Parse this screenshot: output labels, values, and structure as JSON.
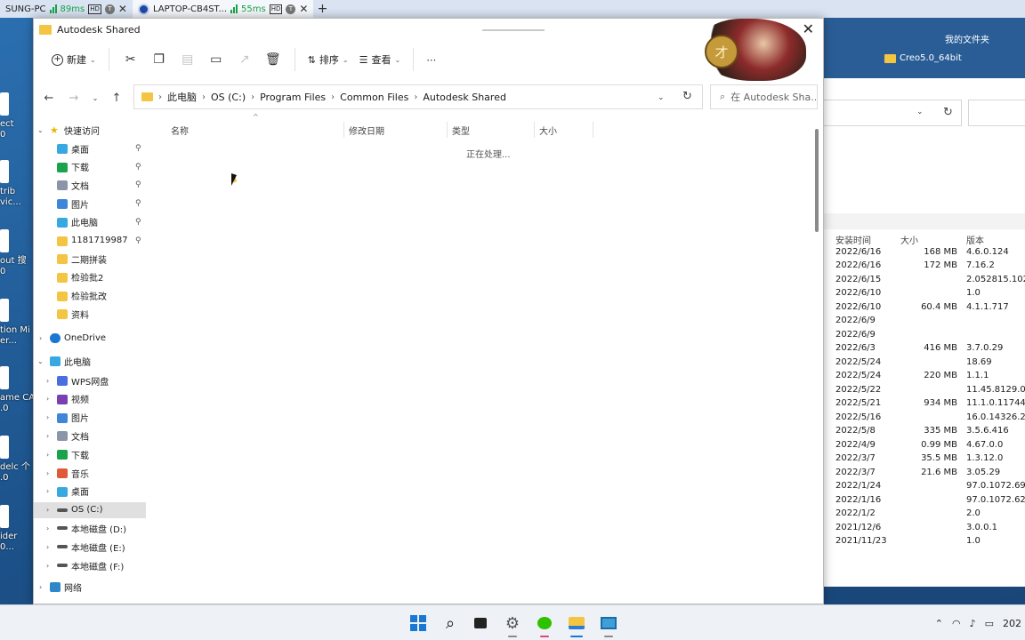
{
  "remote_tabs": [
    {
      "name": "SUNG-PC",
      "latency": "89ms",
      "hd": "HD",
      "t": "T",
      "close": "✕"
    },
    {
      "name": "LAPTOP-CB4ST...",
      "latency": "55ms",
      "hd": "HD",
      "t": "T",
      "close": "✕"
    }
  ],
  "remote_new_tab": "+",
  "desktop_labels": [
    "ect",
    "0",
    "trib",
    "vic...",
    "out",
    "搜",
    "0",
    "tion",
    "er...",
    "Mi",
    "ame",
    "CA",
    ".0",
    "delc",
    "个",
    ".0",
    "ider",
    "0..."
  ],
  "bg_window": {
    "title": "我的文件夹",
    "folder": "Creo5.0_64bit",
    "headers": {
      "date": "安装时间",
      "size": "大小",
      "version": "版本"
    },
    "rows": [
      {
        "date": "2022/6/16",
        "size": "168 MB",
        "version": "4.6.0.124"
      },
      {
        "date": "2022/6/16",
        "size": "172 MB",
        "version": "7.16.2"
      },
      {
        "date": "2022/6/15",
        "size": "",
        "version": "2.052815.102"
      },
      {
        "date": "2022/6/10",
        "size": "",
        "version": "1.0"
      },
      {
        "date": "2022/6/10",
        "size": "60.4 MB",
        "version": "4.1.1.717"
      },
      {
        "date": "2022/6/9",
        "size": "",
        "version": ""
      },
      {
        "date": "2022/6/9",
        "size": "",
        "version": ""
      },
      {
        "date": "2022/6/3",
        "size": "416 MB",
        "version": "3.7.0.29"
      },
      {
        "date": "2022/5/24",
        "size": "",
        "version": "18.69"
      },
      {
        "date": "2022/5/24",
        "size": "220 MB",
        "version": "1.1.1"
      },
      {
        "date": "2022/5/22",
        "size": "",
        "version": "11.45.8129.0"
      },
      {
        "date": "2022/5/21",
        "size": "934 MB",
        "version": "11.1.0.11744"
      },
      {
        "date": "2022/5/16",
        "size": "",
        "version": "16.0.14326.20"
      },
      {
        "date": "2022/5/8",
        "size": "335 MB",
        "version": "3.5.6.416"
      },
      {
        "date": "2022/4/9",
        "size": "0.99 MB",
        "version": "4.67.0.0"
      },
      {
        "date": "2022/3/7",
        "size": "35.5 MB",
        "version": "1.3.12.0"
      },
      {
        "date": "2022/3/7",
        "size": "21.6 MB",
        "version": "3.05.29"
      },
      {
        "date": "2022/1/24",
        "size": "",
        "version": "97.0.1072.69"
      },
      {
        "date": "2022/1/16",
        "size": "",
        "version": "97.0.1072.62"
      },
      {
        "date": "2022/1/2",
        "size": "",
        "version": "2.0"
      },
      {
        "date": "2021/12/6",
        "size": "",
        "version": "3.0.0.1"
      },
      {
        "date": "2021/11/23",
        "size": "",
        "version": "1.0"
      }
    ]
  },
  "explorer": {
    "title": "Autodesk Shared",
    "close": "✕",
    "logo_char": "才",
    "toolbar": {
      "new": "新建",
      "sort": "排序",
      "view": "查看",
      "more": "⋯"
    },
    "breadcrumb": [
      "此电脑",
      "OS (C:)",
      "Program Files",
      "Common Files",
      "Autodesk Shared"
    ],
    "search_placeholder": "在 Autodesk Sha...",
    "columns": {
      "name": "名称",
      "date": "修改日期",
      "type": "类型",
      "size": "大小"
    },
    "status": "正在处理...",
    "quick_access": "快速访问",
    "quick_items": [
      "桌面",
      "下载",
      "文档",
      "图片",
      "此电脑",
      "1181719987",
      "二期拼装",
      "检验批2",
      "检验批改",
      "资料"
    ],
    "onedrive": "OneDrive",
    "this_pc": "此电脑",
    "pc_items": [
      "WPS网盘",
      "视频",
      "图片",
      "文档",
      "下载",
      "音乐",
      "桌面",
      "OS (C:)",
      "本地磁盘 (D:)",
      "本地磁盘 (E:)",
      "本地磁盘 (F:)"
    ],
    "network": "网络"
  },
  "tray_time": "202"
}
